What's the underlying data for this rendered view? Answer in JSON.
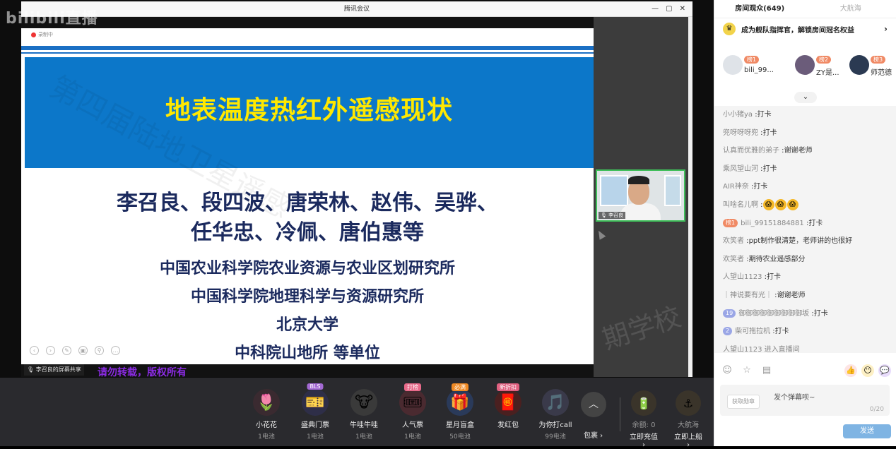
{
  "logo": "bilibili直播",
  "window": {
    "title": "腾讯会议",
    "controls": [
      "—",
      "▢",
      "✕"
    ]
  },
  "slide": {
    "rec_label": "录制中",
    "title": "地表温度热红外遥感现状",
    "authors": [
      "李召良、段四波、唐荣林、赵伟、吴骅、",
      "任华忠、冷佩、唐伯惠等"
    ],
    "institutions": [
      "中国农业科学院农业资源与农业区划研究所",
      "中国科学院地理科学与资源研究所",
      "北京大学",
      "中科院山地所 等单位"
    ]
  },
  "share_label": "李召良的屏幕共享",
  "camera_name": "李召良",
  "watermark": "第四届陆地卫星遥感",
  "watermark2": "期学校",
  "caption": "请勿转载，版权所有",
  "gifts": [
    {
      "name": "小花花",
      "price": "1电池",
      "tag": "",
      "icon": "🌷",
      "bg": "#3a2a30",
      "tagcolor": ""
    },
    {
      "name": "盛典门票",
      "price": "1电池",
      "tag": "BLS",
      "icon": "🎫",
      "bg": "#2e2e48",
      "tagcolor": "#a46ad4"
    },
    {
      "name": "牛哇牛哇",
      "price": "1电池",
      "tag": "",
      "icon": "🐮",
      "bg": "#3a3a3a",
      "tagcolor": ""
    },
    {
      "name": "人气票",
      "price": "1电池",
      "tag": "打榜",
      "icon": "🎟",
      "bg": "#4a2a30",
      "tagcolor": "#e86a8a"
    },
    {
      "name": "星月盲盒",
      "price": "50电池",
      "tag": "必满",
      "icon": "🎁",
      "bg": "#2a3a5a",
      "tagcolor": "#f08a24"
    },
    {
      "name": "发红包",
      "price": "",
      "tag": "新折扣",
      "icon": "🧧",
      "bg": "#4a2020",
      "tagcolor": "#e06080"
    },
    {
      "name": "为你打call",
      "price": "99电池",
      "tag": "",
      "icon": "🎵",
      "bg": "#3a3a4a",
      "tagcolor": ""
    }
  ],
  "package_label": "包裹 ›",
  "wallet": {
    "balance_label": "余额: 0",
    "recharge_label": "立即充值 ›",
    "voyage_label": "大航海",
    "board_label": "立即上船 ›"
  },
  "sidebar": {
    "tab_audience": "房间观众(649)",
    "tab_voyage": "大航海",
    "promo": "成为舰队指挥官，解锁房间冠名权益",
    "ranks": [
      {
        "badge": "榜1",
        "name": "bili_99...",
        "avatar_color": "#dfe3e8"
      },
      {
        "badge": "榜2",
        "name": "ZY是...",
        "avatar_color": "#6b5c7a"
      },
      {
        "badge": "榜3",
        "name": "师范德",
        "avatar_color": "#2b3a52"
      }
    ]
  },
  "chat": [
    {
      "user": "小小猪ya",
      "text": "打卡",
      "level": "",
      "levelcolor": ""
    },
    {
      "user": "兜呀呀呀兜",
      "text": "打卡",
      "level": "",
      "levelcolor": ""
    },
    {
      "user": "认真而优雅的弟子",
      "text": "谢谢老师",
      "level": "",
      "levelcolor": ""
    },
    {
      "user": "乘风望山河",
      "text": "打卡",
      "level": "",
      "levelcolor": ""
    },
    {
      "user": "AIR神奈",
      "text": "打卡",
      "level": "",
      "levelcolor": ""
    },
    {
      "user": "叫啥名儿啊",
      "text": "",
      "level": "",
      "levelcolor": "",
      "emoji": [
        "😱",
        "😱",
        "😱"
      ]
    },
    {
      "user": "bili_99151884881",
      "text": "打卡",
      "level": "榜1",
      "levelcolor": "#f08a65"
    },
    {
      "user": "欢笑者",
      "text": "ppt制作很清楚，老师讲的也很好",
      "level": "",
      "levelcolor": ""
    },
    {
      "user": "欢笑者",
      "text": "期待农业遥感部分",
      "level": "",
      "levelcolor": ""
    },
    {
      "user": "人望山1123",
      "text": "打卡",
      "level": "",
      "levelcolor": ""
    },
    {
      "user": "｜神说要有光｜",
      "text": "谢谢老师",
      "level": "",
      "levelcolor": ""
    },
    {
      "user": "御御御御御御御御御坂",
      "text": "打卡",
      "level": "19",
      "levelcolor": "#9aa6e6"
    },
    {
      "user": "柴可拖拉机",
      "text": "打卡",
      "level": "2",
      "levelcolor": "#9aa6e6"
    },
    {
      "user": "人望山1123",
      "text": "进入直播间",
      "level": "",
      "levelcolor": "",
      "entry": true
    }
  ],
  "input": {
    "fan_label": "获取勋章",
    "placeholder": "发个弹幕呗~",
    "counter": "0/20",
    "send_label": "发送"
  }
}
